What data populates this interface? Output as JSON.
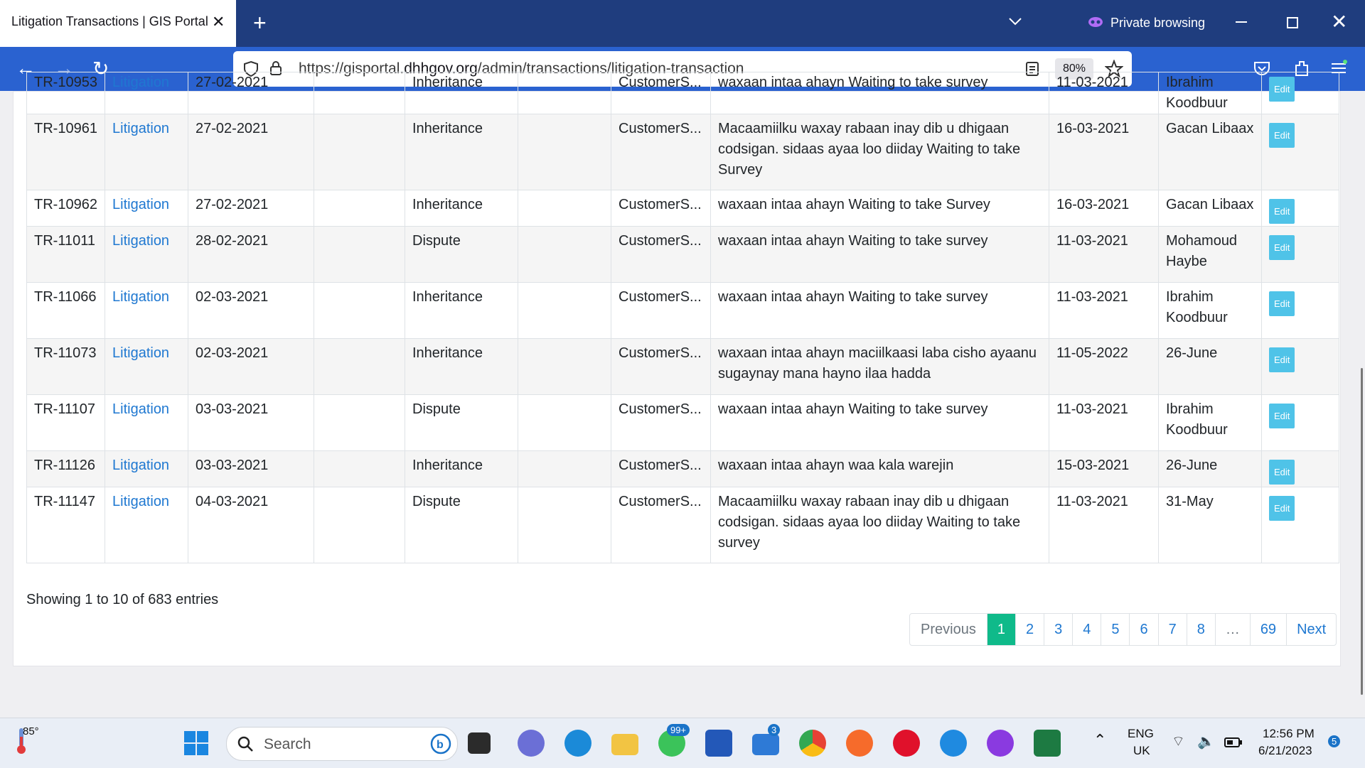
{
  "browser": {
    "tab_title": "Litigation Transactions | GIS Portal",
    "private_label": "Private browsing",
    "url_prefix": "https://gisportal.",
    "url_domain": "dhhgov.org",
    "url_path": "/admin/transactions/litigation-transaction",
    "zoom": "80%"
  },
  "table": {
    "rows": [
      {
        "id": "TR-10953",
        "type": "Litigation",
        "date": "27-02-2021",
        "c4": "",
        "category": "Inheritance",
        "c6": "",
        "customer": "CustomerS...",
        "notes": "waxaan intaa ahayn Waiting to take survey",
        "date2": "11-03-2021",
        "officer": "Ibrahim Koodbuur",
        "edit": "Edit"
      },
      {
        "id": "TR-10961",
        "type": "Litigation",
        "date": "27-02-2021",
        "c4": "",
        "category": "Inheritance",
        "c6": "",
        "customer": "CustomerS...",
        "notes": "Macaamiilku waxay rabaan inay dib u dhigaan codsigan. sidaas ayaa loo diiday Waiting to take Survey",
        "date2": "16-03-2021",
        "officer": "Gacan Libaax",
        "edit": "Edit"
      },
      {
        "id": "TR-10962",
        "type": "Litigation",
        "date": "27-02-2021",
        "c4": "",
        "category": "Inheritance",
        "c6": "",
        "customer": "CustomerS...",
        "notes": "waxaan intaa ahayn Waiting to take Survey",
        "date2": "16-03-2021",
        "officer": "Gacan Libaax",
        "edit": "Edit"
      },
      {
        "id": "TR-11011",
        "type": "Litigation",
        "date": "28-02-2021",
        "c4": "",
        "category": "Dispute",
        "c6": "",
        "customer": "CustomerS...",
        "notes": "waxaan intaa ahayn Waiting to take survey",
        "date2": "11-03-2021",
        "officer": "Mohamoud Haybe",
        "edit": "Edit"
      },
      {
        "id": "TR-11066",
        "type": "Litigation",
        "date": "02-03-2021",
        "c4": "",
        "category": "Inheritance",
        "c6": "",
        "customer": "CustomerS...",
        "notes": "waxaan intaa ahayn Waiting to take survey",
        "date2": "11-03-2021",
        "officer": "Ibrahim Koodbuur",
        "edit": "Edit"
      },
      {
        "id": "TR-11073",
        "type": "Litigation",
        "date": "02-03-2021",
        "c4": "",
        "category": "Inheritance",
        "c6": "",
        "customer": "CustomerS...",
        "notes": "waxaan intaa ahayn maciilkaasi laba cisho ayaanu sugaynay mana hayno ilaa hadda",
        "date2": "11-05-2022",
        "officer": "26-June",
        "edit": "Edit"
      },
      {
        "id": "TR-11107",
        "type": "Litigation",
        "date": "03-03-2021",
        "c4": "",
        "category": "Dispute",
        "c6": "",
        "customer": "CustomerS...",
        "notes": "waxaan intaa ahayn Waiting to take survey",
        "date2": "11-03-2021",
        "officer": "Ibrahim Koodbuur",
        "edit": "Edit"
      },
      {
        "id": "TR-11126",
        "type": "Litigation",
        "date": "03-03-2021",
        "c4": "",
        "category": "Inheritance",
        "c6": "",
        "customer": "CustomerS...",
        "notes": "waxaan intaa ahayn waa kala warejin",
        "date2": "15-03-2021",
        "officer": "26-June",
        "edit": "Edit"
      },
      {
        "id": "TR-11147",
        "type": "Litigation",
        "date": "04-03-2021",
        "c4": "",
        "category": "Dispute",
        "c6": "",
        "customer": "CustomerS...",
        "notes": "Macaamiilku waxay rabaan inay dib u dhigaan codsigan. sidaas ayaa loo diiday Waiting to take survey",
        "date2": "11-03-2021",
        "officer": "31-May",
        "edit": "Edit"
      }
    ]
  },
  "footer": {
    "info": "Showing 1 to 10 of 683 entries",
    "pages": [
      "Previous",
      "1",
      "2",
      "3",
      "4",
      "5",
      "6",
      "7",
      "8",
      "…",
      "69",
      "Next"
    ],
    "active_page": "1"
  },
  "taskbar": {
    "weather": "85°",
    "search_placeholder": "Search",
    "whatsapp_badge": "99+",
    "mail_badge": "3",
    "lang1": "ENG",
    "lang2": "UK",
    "time": "12:56 PM",
    "date": "6/21/2023",
    "notif_count": "5"
  },
  "colors": {
    "accent_green": "#0fba8a",
    "link": "#1f78d1",
    "tab_bg": "#1f3d7e",
    "nav_bg": "#2a62d0"
  }
}
